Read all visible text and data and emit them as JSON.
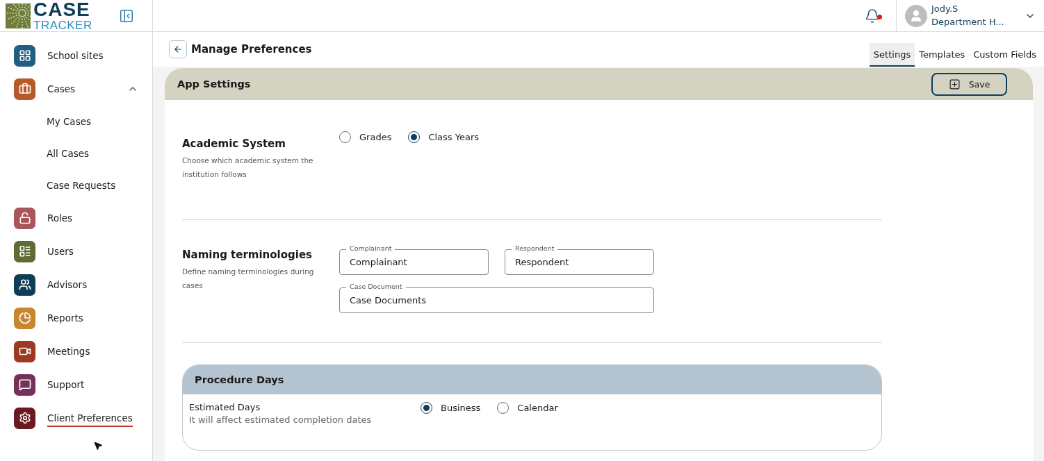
{
  "logo": {
    "line_1": "CASE",
    "line_2": "TRACKER"
  },
  "sidebar": {
    "items": [
      {
        "label": "School sites",
        "color": "#1f5f80",
        "selected": false
      },
      {
        "label": "Cases",
        "color": "#b65a26",
        "selected": false,
        "expanded": true,
        "children": [
          {
            "label": "My Cases",
            "selected": false
          },
          {
            "label": "All Cases",
            "selected": false
          },
          {
            "label": "Case Requests",
            "selected": false
          }
        ]
      },
      {
        "label": "Roles",
        "color": "#a8555b",
        "selected": false
      },
      {
        "label": "Users",
        "color": "#5e6b32",
        "selected": false
      },
      {
        "label": "Advisors",
        "color": "#0f3d57",
        "selected": false
      },
      {
        "label": "Reports",
        "color": "#c8862f",
        "selected": false
      },
      {
        "label": "Meetings",
        "color": "#9b3a20",
        "selected": false
      },
      {
        "label": "Support",
        "color": "#74325a",
        "selected": false
      },
      {
        "label": "Client Preferences",
        "color": "#6b1a1f",
        "selected": true
      }
    ]
  },
  "topbar": {
    "notifications": {
      "unread": true
    },
    "user": {
      "name": "Jody.S",
      "role": "Department H..."
    }
  },
  "page": {
    "title": "Manage Preferences",
    "tabs": [
      {
        "label": "Settings",
        "selected": true
      },
      {
        "label": "Templates",
        "selected": false
      },
      {
        "label": "Custom Fields",
        "selected": false
      }
    ]
  },
  "panel": {
    "title": "App Settings",
    "save_button": "Save",
    "academic": {
      "title": "Academic System",
      "description": "Choose which academic system the institution follows",
      "options": [
        {
          "label": "Grades",
          "selected": false
        },
        {
          "label": "Class Years",
          "selected": true
        }
      ]
    },
    "naming": {
      "title": "Naming terminologies",
      "description": "Define naming terminologies during cases",
      "fields": [
        {
          "label": "Complainant",
          "value": "Complainant"
        },
        {
          "label": "Respondent",
          "value": "Respondent"
        },
        {
          "label": "Case Document",
          "value": "Case Documents"
        }
      ]
    },
    "procedure": {
      "title": "Procedure Days",
      "label": "Estimated Days",
      "description": "It will affect estimated completion dates",
      "options": [
        {
          "label": "Business",
          "selected": true
        },
        {
          "label": "Calendar",
          "selected": false
        }
      ]
    }
  }
}
